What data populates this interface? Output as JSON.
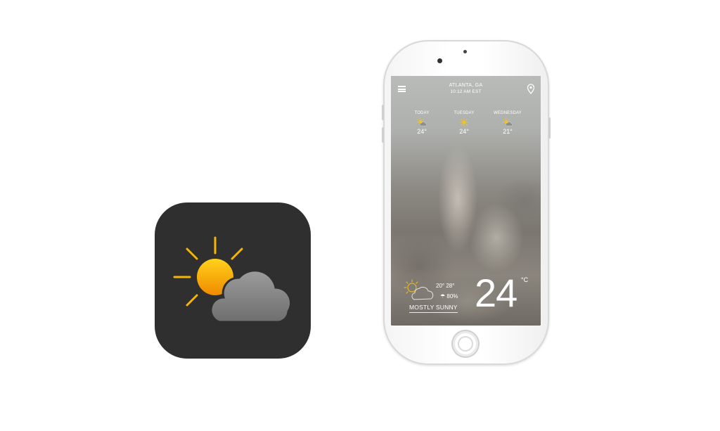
{
  "app_icon": {
    "icon": "partly-sunny-icon",
    "colors": {
      "background": "#2f2f2f",
      "sun": "#f7b500",
      "cloud": "#8f8f8f"
    }
  },
  "weather": {
    "location": "ATLANTA, GA",
    "time": "10:12 AM EST",
    "menu_icon": "hamburger-menu-icon",
    "location_pin_icon": "location-pin-icon",
    "forecast": [
      {
        "day": "TODAY",
        "icon": "partly-sunny-icon",
        "temp": "24°"
      },
      {
        "day": "TUESDAY",
        "icon": "sunny-icon",
        "temp": "24°"
      },
      {
        "day": "WEDNESDAY",
        "icon": "partly-sunny-icon",
        "temp": "21°"
      }
    ],
    "current": {
      "icon": "partly-sunny-icon",
      "high_low": "20° 28°",
      "rain_icon": "umbrella-icon",
      "rain_chance": "80%",
      "condition": "MOSTLY SUNNY",
      "temperature": "24",
      "unit": "°C"
    }
  }
}
